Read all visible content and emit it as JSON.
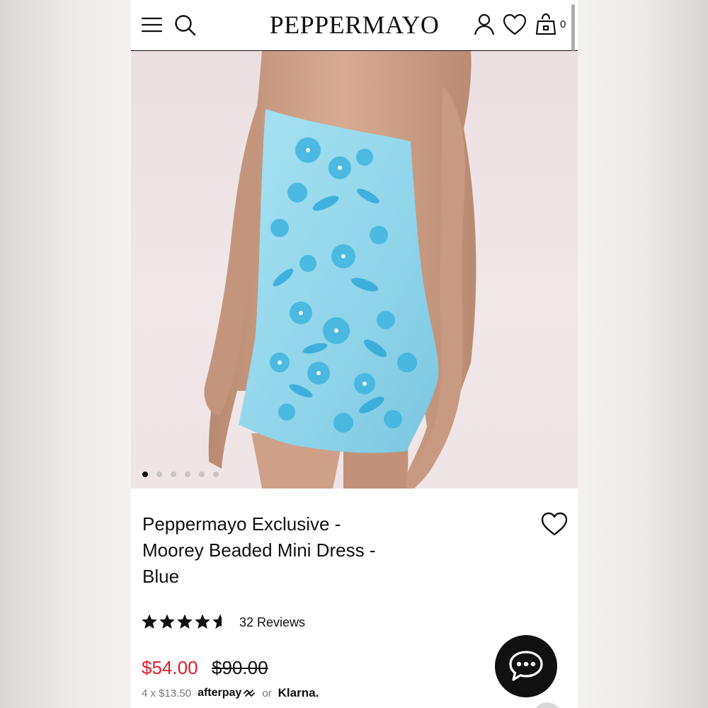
{
  "header": {
    "brand": "PEPPERMAYO",
    "bag_count": "0",
    "icons": [
      "menu-icon",
      "search-icon",
      "account-icon",
      "heart-icon",
      "bag-icon"
    ]
  },
  "gallery": {
    "slides": 6,
    "active_slide": 1
  },
  "product": {
    "title_line1": "Peppermayo Exclusive -",
    "title_line2": "Moorey Beaded Mini Dress -",
    "title_line3": "Blue",
    "rating": 4.5,
    "reviews": "32 Reviews",
    "sale_price": "$54.00",
    "original_price": "$90.00",
    "installments": "4 x $13.50",
    "afterpay_label": "afterpay",
    "or_text": "or",
    "klarna_label": "Klarna."
  },
  "colors": {
    "sale_red": "#e11d2a",
    "dress_blue": "#8fd4ea",
    "accent_black": "#111111"
  }
}
